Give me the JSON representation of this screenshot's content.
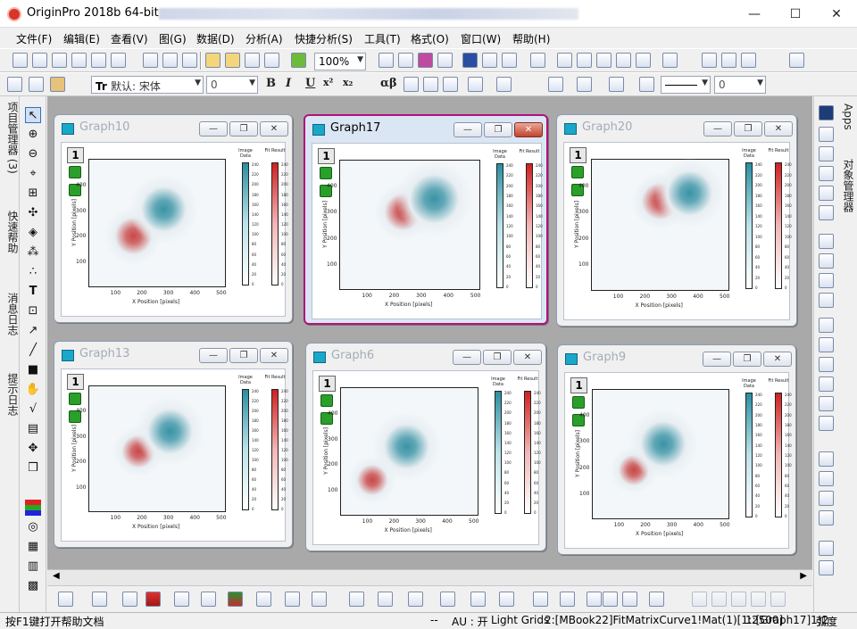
{
  "window": {
    "title": "OriginPro 2018b 64-bit - ",
    "minimize": "—",
    "maximize": "☐",
    "close": "✕"
  },
  "menu": [
    "文件(F)",
    "编辑(E)",
    "查看(V)",
    "图(G)",
    "数据(D)",
    "分析(A)",
    "快捷分析(S)",
    "工具(T)",
    "格式(O)",
    "窗口(W)",
    "帮助(H)"
  ],
  "toolbar": {
    "zoom": "100%",
    "font": "默认: 宋体",
    "font_size": "0",
    "line_width": "0",
    "bold": "B",
    "italic": "I",
    "underline": "U",
    "greek": "αβ",
    "superscript": "x²",
    "subscript": "x₂"
  },
  "left_tabs": [
    "项目管理器 (3)",
    "快速帮助",
    "消息日志",
    "提示日志"
  ],
  "right_tabs": [
    "Apps",
    "对象管理器"
  ],
  "graphs": [
    {
      "name": "Graph10",
      "layer": "1",
      "active": false,
      "blobs": [
        {
          "cx": 170,
          "cy": 200,
          "r": 18,
          "color": "#c84848"
        },
        {
          "cx": 285,
          "cy": 305,
          "r": 22,
          "color": "#3a93a5"
        }
      ]
    },
    {
      "name": "Graph17",
      "layer": "1",
      "active": true,
      "blobs": [
        {
          "cx": 235,
          "cy": 300,
          "r": 18,
          "color": "#c84848"
        },
        {
          "cx": 350,
          "cy": 350,
          "r": 24,
          "color": "#3a93a5"
        }
      ]
    },
    {
      "name": "Graph20",
      "layer": "1",
      "active": false,
      "blobs": [
        {
          "cx": 260,
          "cy": 340,
          "r": 18,
          "color": "#c84848"
        },
        {
          "cx": 370,
          "cy": 370,
          "r": 22,
          "color": "#3a93a5"
        }
      ]
    },
    {
      "name": "Graph13",
      "layer": "1",
      "active": false,
      "blobs": [
        {
          "cx": 190,
          "cy": 240,
          "r": 16,
          "color": "#c84848"
        },
        {
          "cx": 310,
          "cy": 320,
          "r": 22,
          "color": "#3a93a5"
        }
      ]
    },
    {
      "name": "Graph6",
      "layer": "1",
      "active": false,
      "blobs": [
        {
          "cx": 120,
          "cy": 140,
          "r": 15,
          "color": "#c84848"
        },
        {
          "cx": 250,
          "cy": 270,
          "r": 22,
          "color": "#3a93a5"
        }
      ]
    },
    {
      "name": "Graph9",
      "layer": "1",
      "active": false,
      "blobs": [
        {
          "cx": 160,
          "cy": 190,
          "r": 15,
          "color": "#c84848"
        },
        {
          "cx": 270,
          "cy": 290,
          "r": 22,
          "color": "#3a93a5"
        }
      ]
    }
  ],
  "plot_axes": {
    "xlabel": "X Position [pixels]",
    "ylabel": "Y Position [pixels]",
    "xticks": [
      "100",
      "200",
      "300",
      "400",
      "500"
    ],
    "yticks": [
      "100",
      "200",
      "300",
      "400"
    ],
    "colorbar1_label": "Image Data",
    "colorbar2_label": "Fit Result",
    "colorbar1_ticks": [
      "240",
      "220",
      "200",
      "180",
      "160",
      "140",
      "120",
      "100",
      "80",
      "60",
      "40",
      "20",
      "0"
    ],
    "colorbar2_ticks": [
      "240",
      "220",
      "200",
      "180",
      "160",
      "140",
      "120",
      "100",
      "80",
      "60",
      "40",
      "20",
      "0"
    ]
  },
  "status": {
    "help": "按F1键打开帮助文档",
    "dots": "--",
    "au": "AU : 开",
    "grids": "Light Grids",
    "book": "2:[MBook22]FitMatrixCurve1!Mat(1)[1:2500]",
    "graph": "1:[Graph17]1!2",
    "angle": "弧度"
  }
}
